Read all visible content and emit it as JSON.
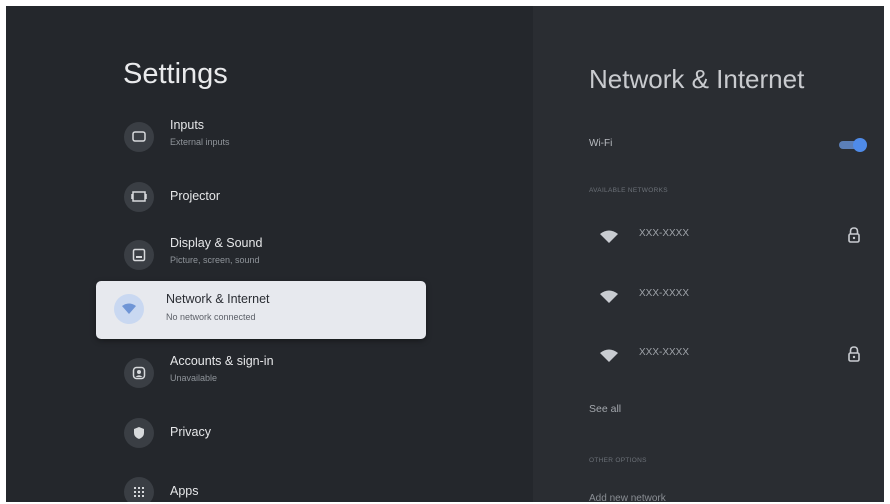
{
  "settings": {
    "title": "Settings",
    "items": [
      {
        "id": "inputs",
        "label": "Inputs",
        "sublabel": "External inputs",
        "icon": "input-icon"
      },
      {
        "id": "projector",
        "label": "Projector",
        "sublabel": "",
        "icon": "projector-icon"
      },
      {
        "id": "display-sound",
        "label": "Display & Sound",
        "sublabel": "Picture, screen, sound",
        "icon": "display-icon"
      },
      {
        "id": "network-internet",
        "label": "Network & Internet",
        "sublabel": "No network connected",
        "icon": "wifi-icon",
        "selected": true
      },
      {
        "id": "accounts",
        "label": "Accounts & sign-in",
        "sublabel": "Unavailable",
        "icon": "account-icon"
      },
      {
        "id": "privacy",
        "label": "Privacy",
        "sublabel": "",
        "icon": "shield-icon"
      },
      {
        "id": "apps",
        "label": "Apps",
        "sublabel": "",
        "icon": "apps-grid-icon"
      }
    ]
  },
  "network": {
    "title": "Network & Internet",
    "wifi_label": "Wi-Fi",
    "wifi_enabled": true,
    "available_label": "AVAILABLE NETWORKS",
    "networks": [
      {
        "name": "XXX-XXXX",
        "locked": true
      },
      {
        "name": "XXX-XXXX",
        "locked": false
      },
      {
        "name": "XXX-XXXX",
        "locked": true
      }
    ],
    "see_all_label": "See all",
    "other_options_label": "OTHER OPTIONS",
    "add_network_label": "Add new network"
  },
  "colors": {
    "background": "#24272c",
    "panel": "#2a2d32",
    "selected_item": "#e7e9ee",
    "accent": "#4f8be8"
  }
}
